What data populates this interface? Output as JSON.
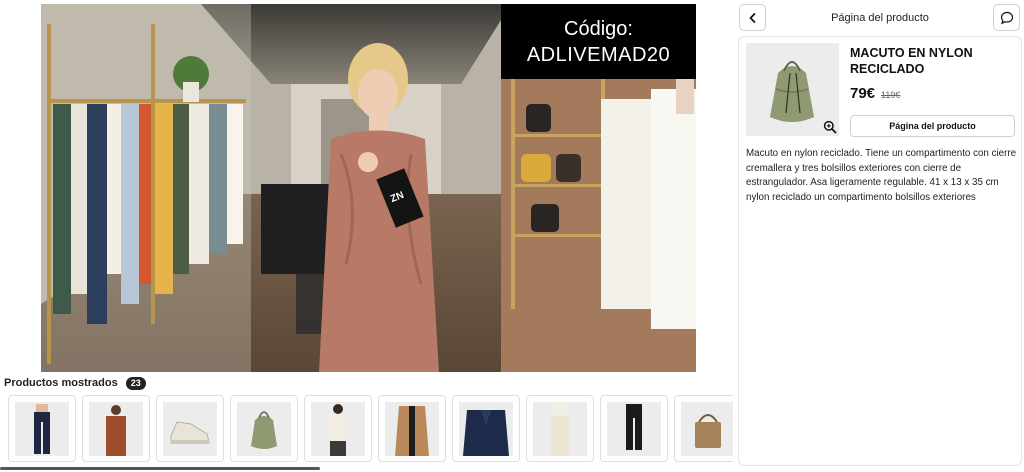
{
  "video": {
    "code_title": "Código:",
    "code_value": "ADLIVEMAD20",
    "presenter_card_text": "ZN"
  },
  "products_strip": {
    "title": "Productos mostrados",
    "count": "23",
    "items": [
      {
        "name": "dark-trousers"
      },
      {
        "name": "rust-overshirt-outfit"
      },
      {
        "name": "white-sneakers"
      },
      {
        "name": "khaki-drawstring-backpack"
      },
      {
        "name": "white-shirt-outfit"
      },
      {
        "name": "camel-coat"
      },
      {
        "name": "navy-blazer"
      },
      {
        "name": "white-trousers"
      },
      {
        "name": "black-trousers"
      },
      {
        "name": "tan-tote-bag"
      }
    ]
  },
  "panel": {
    "title": "Página del producto",
    "back_icon": "chevron-left-icon",
    "chat_icon": "chat-bubble-icon",
    "product": {
      "name": "MACUTO EN NYLON RECICLADO",
      "price": "79€",
      "old_price": "119€",
      "button_label": "Página del producto",
      "description": "Macuto en nylon reciclado. Tiene un compartimento con cierre cremallera y tres bolsillos exteriores con cierre de estrangulador. Asa ligeramente regulable. 41 x 13 x 35 cm nylon reciclado un compartimento bolsillos exteriores"
    }
  },
  "colors": {
    "badge_bg": "#222222",
    "backpack_khaki": "#8f9a72",
    "code_box_bg": "#000000"
  }
}
